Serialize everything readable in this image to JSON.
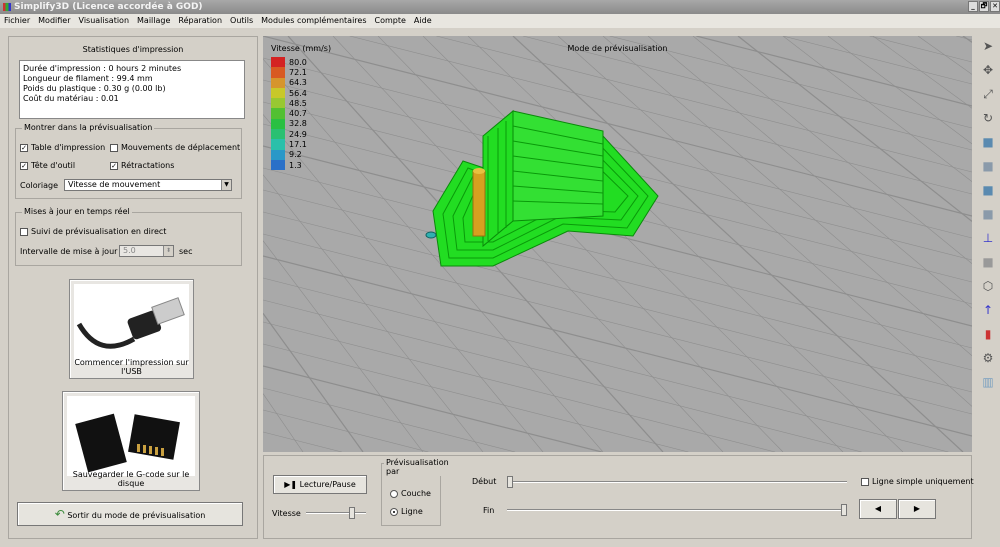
{
  "window": {
    "title": "Simplify3D (Licence accordée à GOD)",
    "buttons": [
      "_",
      "🗗",
      "✕"
    ]
  },
  "menu": [
    "Fichier",
    "Modifier",
    "Visualisation",
    "Maillage",
    "Réparation",
    "Outils",
    "Modules complémentaires",
    "Compte",
    "Aide"
  ],
  "stats": {
    "title": "Statistiques d'impression",
    "lines": [
      "Durée d'impression : 0 hours 2 minutes",
      "Longueur de filament : 99.4 mm",
      "Poids du plastique : 0.30 g (0.00 lb)",
      "Coût du matériau : 0.01"
    ]
  },
  "show": {
    "title": "Montrer dans la prévisualisation",
    "items": [
      {
        "label": "Table d'impression",
        "checked": true
      },
      {
        "label": "Mouvements de déplacement",
        "checked": false
      },
      {
        "label": "Tête d'outil",
        "checked": true
      },
      {
        "label": "Rétractations",
        "checked": true
      }
    ],
    "coloring_label": "Coloriage",
    "coloring_value": "Vitesse de mouvement"
  },
  "realtime": {
    "title": "Mises à jour en temps réel",
    "follow_label": "Suivi de prévisualisation en direct",
    "interval_label": "Intervalle de mise à jour",
    "interval_value": "5.0",
    "unit": "sec"
  },
  "usb_button": "Commencer l'impression sur l'USB",
  "sd_button": "Sauvegarder le G-code sur le disque",
  "exit_button": "Sortir du mode de prévisualisation",
  "viewport": {
    "title": "Mode de prévisualisation",
    "legend_title": "Vitesse (mm/s)",
    "legend": [
      {
        "v": "80.0",
        "c": "#d42222"
      },
      {
        "v": "72.1",
        "c": "#d85a22"
      },
      {
        "v": "64.3",
        "c": "#d6952c"
      },
      {
        "v": "56.4",
        "c": "#c8c82a"
      },
      {
        "v": "48.5",
        "c": "#98c832"
      },
      {
        "v": "40.7",
        "c": "#52c032"
      },
      {
        "v": "32.8",
        "c": "#2ac042"
      },
      {
        "v": "24.9",
        "c": "#2ac072"
      },
      {
        "v": "17.1",
        "c": "#2ac0aa"
      },
      {
        "v": "9.2",
        "c": "#2a98c8"
      },
      {
        "v": "1.3",
        "c": "#2a70c8"
      }
    ]
  },
  "controls": {
    "play": "Lecture/Pause",
    "speed": "Vitesse",
    "preview_by": "Prévisualisation par",
    "layer": "Couche",
    "line": "Ligne",
    "start": "Début",
    "end": "Fin",
    "single_line": "Ligne simple uniquement",
    "speed_pct": 80,
    "start_pct": 0,
    "end_pct": 100
  }
}
